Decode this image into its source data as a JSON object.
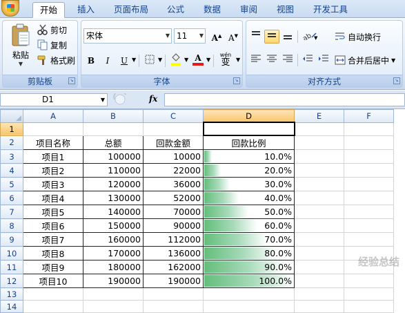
{
  "ribbon_tabs": [
    "开始",
    "插入",
    "页面布局",
    "公式",
    "数据",
    "审阅",
    "视图",
    "开发工具"
  ],
  "clipboard": {
    "paste": "粘贴",
    "cut": "剪切",
    "copy": "复制",
    "format_painter": "格式刷",
    "group": "剪贴板"
  },
  "font": {
    "name": "宋体",
    "size": "11",
    "bold": "B",
    "italic": "I",
    "underline": "U",
    "grow": "A",
    "shrink": "A",
    "group": "字体",
    "wen": "wén",
    "wen_char": "变"
  },
  "alignment": {
    "wrap": "自动换行",
    "merge": "合并后居中",
    "group": "对齐方式"
  },
  "formula_bar": {
    "cell_ref": "D1",
    "fx": "fx",
    "value": ""
  },
  "columns": [
    "A",
    "B",
    "C",
    "D",
    "E",
    "F"
  ],
  "rows": [
    {
      "n": "1",
      "a": "",
      "b": "",
      "c": "",
      "d": ""
    },
    {
      "n": "2",
      "a": "项目名称",
      "b": "总额",
      "c": "回款金额",
      "d": "回款比例"
    },
    {
      "n": "3",
      "a": "项目1",
      "b": "100000",
      "c": "10000",
      "d": "10.0%",
      "pct": 0.1
    },
    {
      "n": "4",
      "a": "项目2",
      "b": "110000",
      "c": "22000",
      "d": "20.0%",
      "pct": 0.2
    },
    {
      "n": "5",
      "a": "项目3",
      "b": "120000",
      "c": "36000",
      "d": "30.0%",
      "pct": 0.3
    },
    {
      "n": "6",
      "a": "项目4",
      "b": "130000",
      "c": "52000",
      "d": "40.0%",
      "pct": 0.4
    },
    {
      "n": "7",
      "a": "项目5",
      "b": "140000",
      "c": "70000",
      "d": "50.0%",
      "pct": 0.5
    },
    {
      "n": "8",
      "a": "项目6",
      "b": "150000",
      "c": "90000",
      "d": "60.0%",
      "pct": 0.6
    },
    {
      "n": "9",
      "a": "项目7",
      "b": "160000",
      "c": "112000",
      "d": "70.0%",
      "pct": 0.7
    },
    {
      "n": "10",
      "a": "项目8",
      "b": "170000",
      "c": "136000",
      "d": "80.0%",
      "pct": 0.8
    },
    {
      "n": "11",
      "a": "项目9",
      "b": "180000",
      "c": "162000",
      "d": "90.0%",
      "pct": 0.9
    },
    {
      "n": "12",
      "a": "项目10",
      "b": "190000",
      "c": "190000",
      "d": "100.0%",
      "pct": 1.0
    },
    {
      "n": "13",
      "a": "",
      "b": "",
      "c": "",
      "d": ""
    },
    {
      "n": "14",
      "a": "",
      "b": "",
      "c": "",
      "d": ""
    }
  ],
  "watermark": "经验总结"
}
